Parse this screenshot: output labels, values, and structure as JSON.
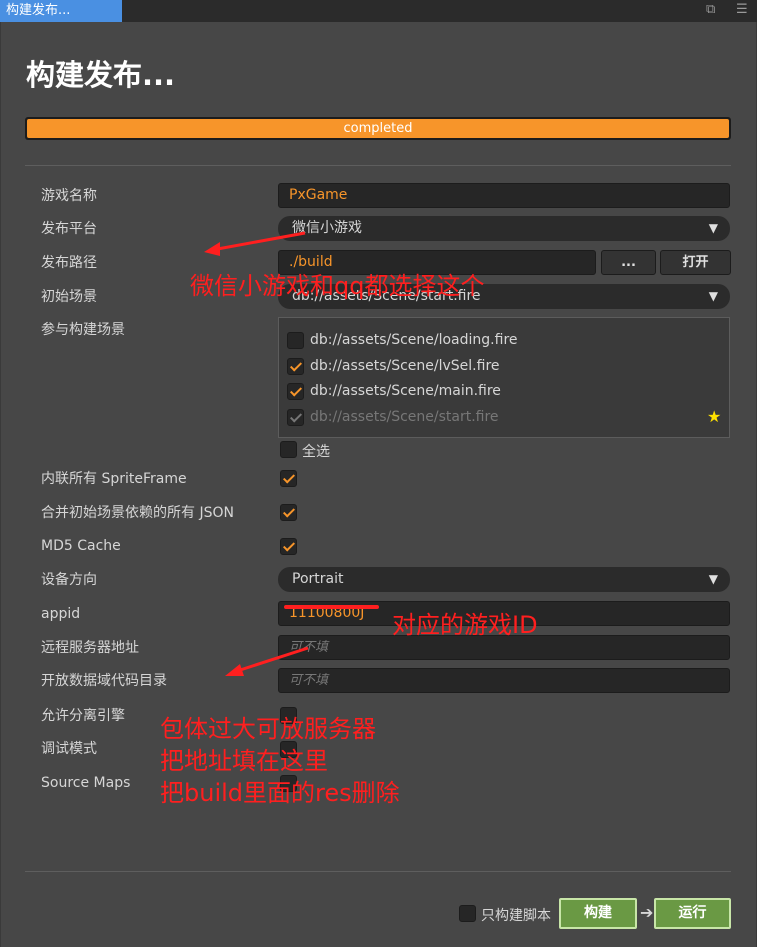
{
  "window": {
    "tab_title": "构建发布..."
  },
  "header": {
    "title": "构建发布..."
  },
  "progress": {
    "status": "completed",
    "percent": 100,
    "fill_color": "#f7952a"
  },
  "form": {
    "game_name_label": "游戏名称",
    "game_name_value": "PxGame",
    "platform_label": "发布平台",
    "platform_value": "微信小游戏",
    "path_label": "发布路径",
    "path_value": "./build",
    "path_browse": "...",
    "path_open": "打开",
    "start_scene_label": "初始场景",
    "start_scene_value": "db://assets/Scene/start.fire",
    "scenes_label": "参与构建场景",
    "scenes": [
      {
        "name": "db://assets/Scene/loading.fire",
        "checked": false
      },
      {
        "name": "db://assets/Scene/lvSel.fire",
        "checked": true
      },
      {
        "name": "db://assets/Scene/main.fire",
        "checked": true
      },
      {
        "name": "db://assets/Scene/start.fire",
        "checked": true
      }
    ],
    "select_all": "全选",
    "inline_sprite_label": "内联所有 SpriteFrame",
    "merge_json_label": "合并初始场景依赖的所有 JSON",
    "md5_label": "MD5 Cache",
    "orientation_label": "设备方向",
    "orientation_value": "Portrait",
    "appid_label": "appid",
    "appid_value": "11100800J",
    "remote_label": "远程服务器地址",
    "remote_placeholder": "可不填",
    "open_data_label": "开放数据域代码目录",
    "open_data_placeholder": "可不填",
    "subpackage_label": "允许分离引擎",
    "debug_label": "调试模式",
    "sourcemaps_label": "Source Maps"
  },
  "footer": {
    "script_only": "只构建脚本",
    "build": "构建",
    "run": "运行"
  },
  "annotations": {
    "platform_note": "微信小游戏和qq都选择这个",
    "appid_note": "对应的游戏ID",
    "remote_note_1": "包体过大可放服务器",
    "remote_note_2": "把地址填在这里",
    "remote_note_3": "把build里面的res删除",
    "color": "#ff1f1f"
  }
}
